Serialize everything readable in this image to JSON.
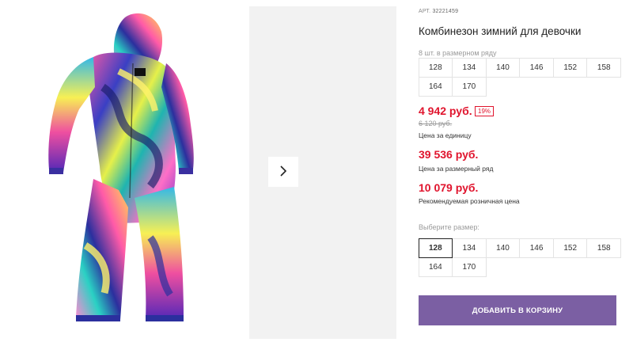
{
  "product": {
    "article_label": "АРТ.",
    "article_number": "32221459",
    "title": "Комбинезон зимний для девочки"
  },
  "size_row": {
    "count_label": "8 шт. в размерном ряду",
    "sizes": [
      "128",
      "134",
      "140",
      "146",
      "152",
      "158",
      "164",
      "170"
    ]
  },
  "prices": {
    "unit_price": "4 942 руб.",
    "discount": "19%",
    "old_price": "6 120 руб.",
    "unit_caption": "Цена за единицу",
    "row_price": "39 536 руб.",
    "row_caption": "Цена за размерный ряд",
    "retail_price": "10 079 руб.",
    "retail_caption": "Рекомендуемая розничная цена"
  },
  "size_select": {
    "label": "Выберите размер:",
    "sizes": [
      "128",
      "134",
      "140",
      "146",
      "152",
      "158",
      "164",
      "170"
    ],
    "selected": "128"
  },
  "actions": {
    "add_to_cart": "ДОБАВИТЬ В КОРЗИНУ"
  },
  "colors": {
    "accent": "#7b5fa3",
    "price": "#e0142d"
  },
  "icons": {
    "next": "chevron-right-icon"
  }
}
